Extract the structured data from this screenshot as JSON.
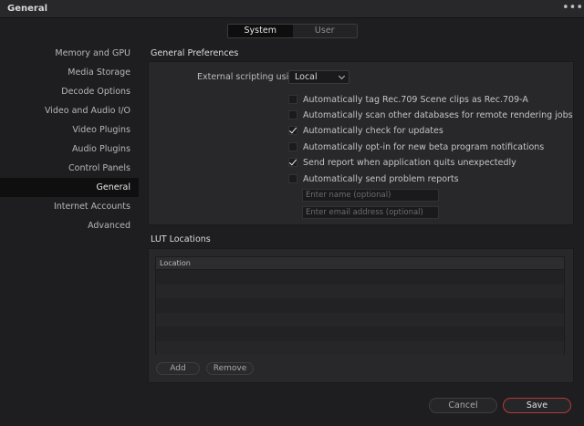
{
  "window": {
    "title": "General",
    "menu_icon": "more-dots-icon",
    "menu_glyph": "•••"
  },
  "segments": {
    "system": "System",
    "user": "User",
    "selected": "System"
  },
  "sidebar": {
    "items": [
      {
        "label": "Memory and GPU"
      },
      {
        "label": "Media Storage"
      },
      {
        "label": "Decode Options"
      },
      {
        "label": "Video and Audio I/O"
      },
      {
        "label": "Video Plugins"
      },
      {
        "label": "Audio Plugins"
      },
      {
        "label": "Control Panels"
      },
      {
        "label": "General"
      },
      {
        "label": "Internet Accounts"
      },
      {
        "label": "Advanced"
      }
    ],
    "selected": "General"
  },
  "general_preferences": {
    "title": "General Preferences",
    "scripting_label": "External scripting using",
    "scripting_value": "Local",
    "options": [
      {
        "label": "Automatically tag Rec.709 Scene clips as Rec.709-A",
        "checked": false
      },
      {
        "label": "Automatically scan other databases for remote rendering jobs",
        "checked": false
      },
      {
        "label": "Automatically check for updates",
        "checked": true
      },
      {
        "label": "Automatically opt-in for new beta program notifications",
        "checked": false
      },
      {
        "label": "Send report when application quits unexpectedly",
        "checked": true
      },
      {
        "label": "Automatically send problem reports",
        "checked": false
      }
    ],
    "name_placeholder": "Enter name (optional)",
    "email_placeholder": "Enter email address (optional)"
  },
  "lut_locations": {
    "title": "LUT Locations",
    "column_header": "Location",
    "add_label": "Add",
    "remove_label": "Remove"
  },
  "footer": {
    "cancel_label": "Cancel",
    "save_label": "Save"
  },
  "colors": {
    "accent_save_border": "#b33a3a",
    "selected_bg": "#0f0f10",
    "panel_bg": "#28282b"
  }
}
